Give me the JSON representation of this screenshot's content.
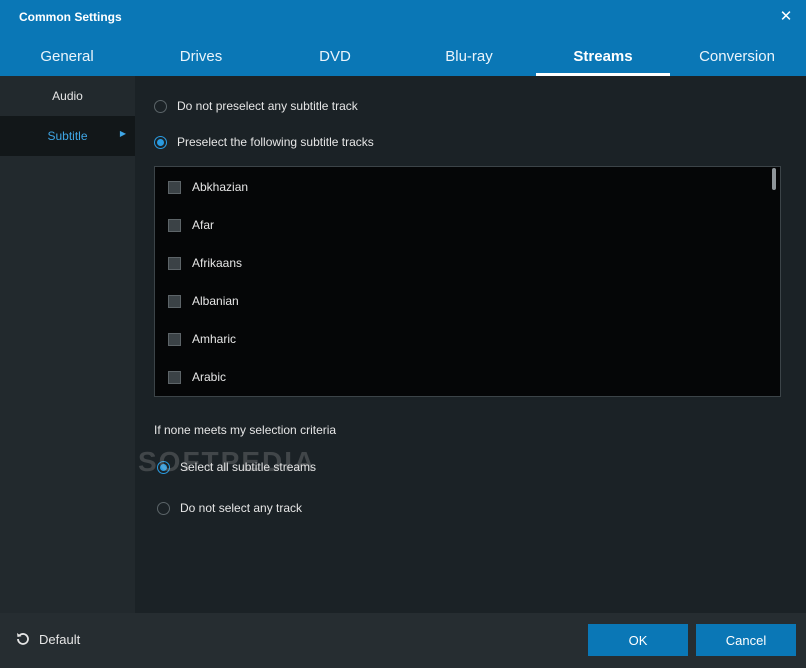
{
  "window": {
    "title": "Common Settings"
  },
  "tabs": [
    {
      "label": "General"
    },
    {
      "label": "Drives"
    },
    {
      "label": "DVD"
    },
    {
      "label": "Blu-ray"
    },
    {
      "label": "Streams",
      "active": true
    },
    {
      "label": "Conversion"
    }
  ],
  "sidebar": {
    "items": [
      {
        "label": "Audio"
      },
      {
        "label": "Subtitle",
        "active": true
      }
    ]
  },
  "preselect": {
    "option_none": "Do not preselect any subtitle track",
    "option_following": "Preselect the following subtitle tracks",
    "selected": "following"
  },
  "languages": [
    "Abkhazian",
    "Afar",
    "Afrikaans",
    "Albanian",
    "Amharic",
    "Arabic"
  ],
  "fallback": {
    "label": "If none meets my selection criteria",
    "option_all": "Select all subtitle streams",
    "option_none": "Do not select any track",
    "selected": "all"
  },
  "watermark": "SOFTPEDIA",
  "footer": {
    "default_label": "Default",
    "ok_label": "OK",
    "cancel_label": "Cancel"
  },
  "colors": {
    "accent": "#0a77b6",
    "radio_checked": "#2a9be0",
    "sidebar_active_text": "#3fa6e6",
    "background": "#1b2226",
    "list_background": "#050607"
  }
}
